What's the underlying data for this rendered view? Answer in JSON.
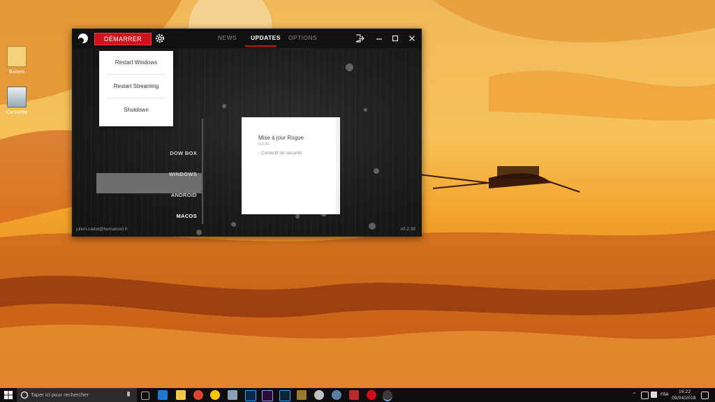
{
  "desktop": {
    "icons": [
      {
        "label": "Bolero",
        "icon": "folder-icon"
      },
      {
        "label": "Corbeille",
        "icon": "recycle-bin-icon"
      }
    ]
  },
  "app": {
    "start_label": "DÉMARRER",
    "tabs": [
      {
        "label": "NEWS",
        "active": false
      },
      {
        "label": "UPDATES",
        "active": true
      },
      {
        "label": "OPTIONS",
        "active": false
      }
    ],
    "dropdown": [
      "Restart Windows",
      "Restart Streaming",
      "Shutdown"
    ],
    "os_list": [
      "DOW BOX",
      "WINDOWS",
      "ANDROID",
      "MACOS"
    ],
    "os_selected": "MACOS",
    "update": {
      "title": "Mise à jour Rogue",
      "version": "0.2.39",
      "note": "- Correctif de sécurité"
    },
    "email": "julien.cadot@humanoid.fr",
    "version": "v0.2.39",
    "accent": "#d0121b"
  },
  "taskbar": {
    "search_placeholder": "Taper ici pour rechercher",
    "lang": "FRA",
    "time": "16:22",
    "date": "09/04/2018"
  }
}
